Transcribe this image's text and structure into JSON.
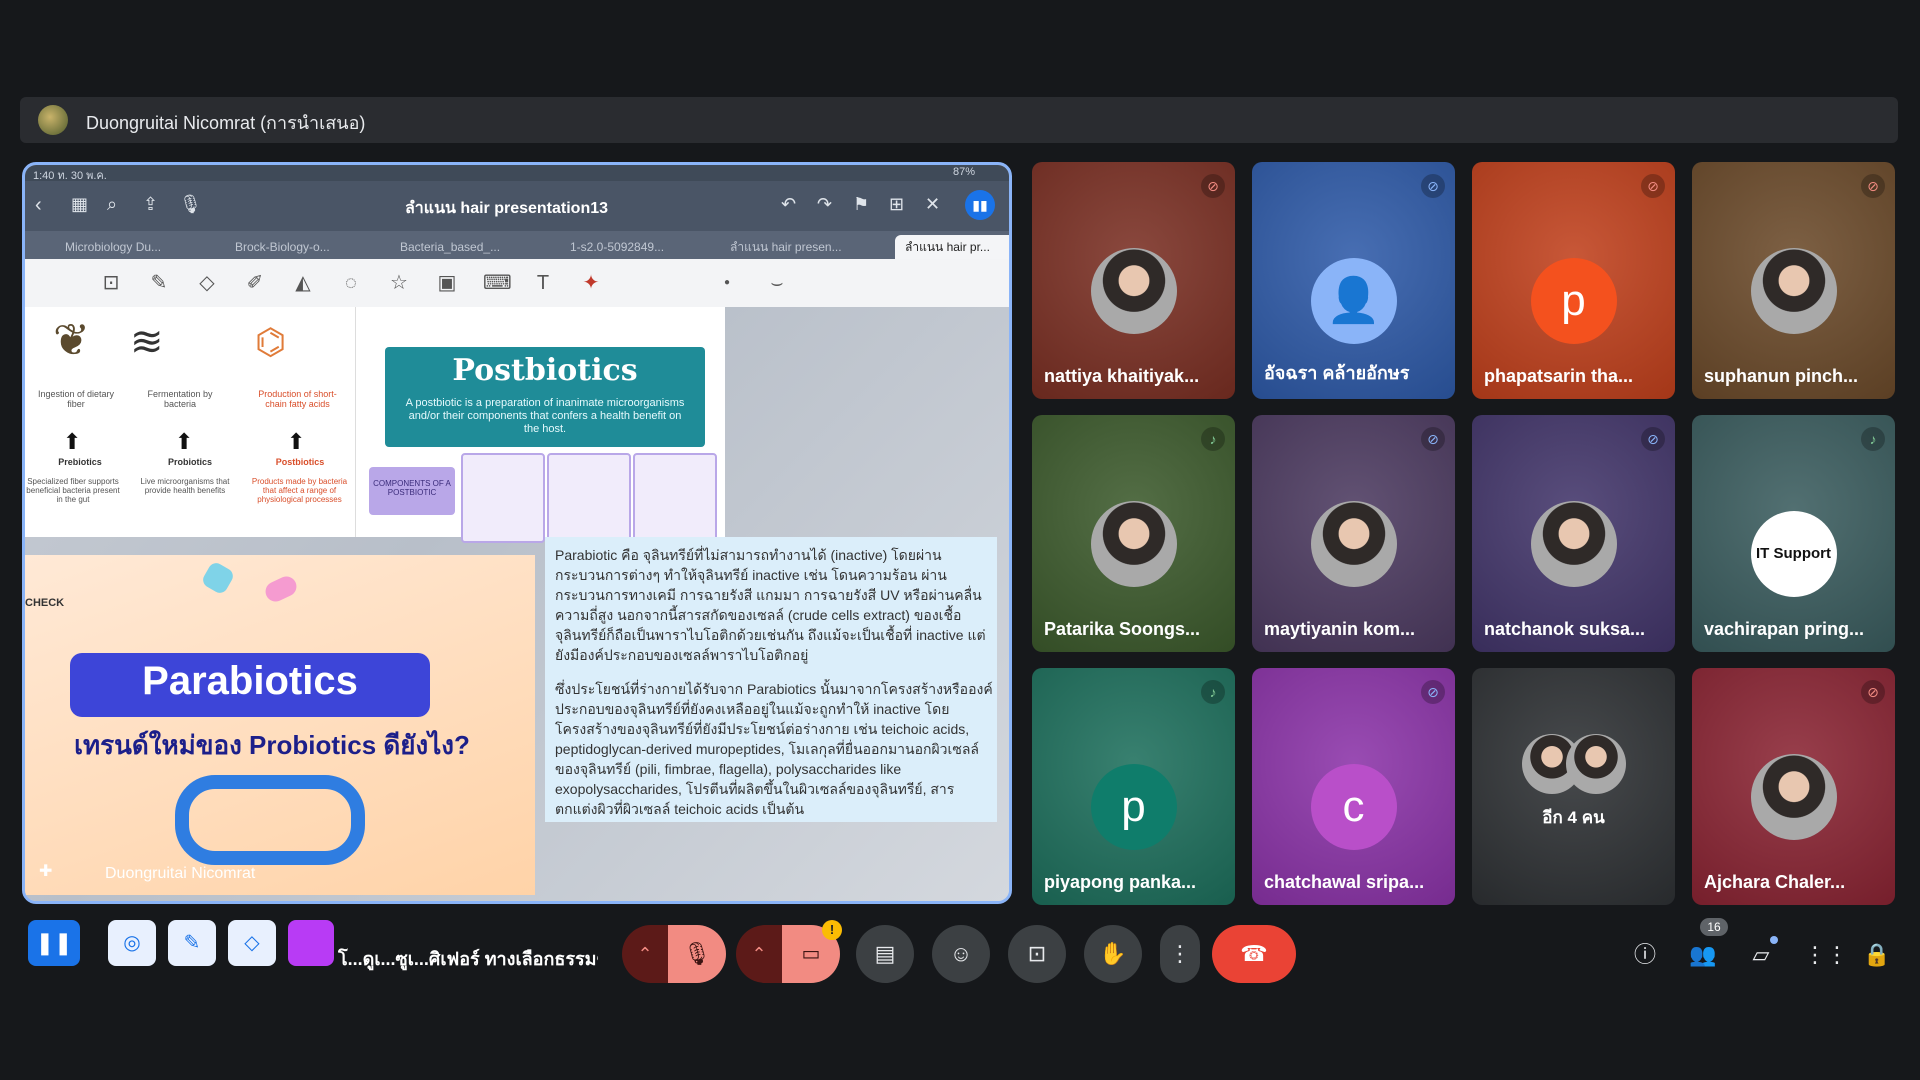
{
  "presenter": {
    "name": "Duongruitai Nicomrat (การนำเสนอ)"
  },
  "shared_screen": {
    "status_time": "1:40 ท. 30 พ.ค.",
    "battery": "87%",
    "doc_title": "ลำแนน hair presentation13",
    "tabs": [
      "Microbiology Du...",
      "Brock-Biology-o...",
      "Bacteria_based_...",
      "1-s2.0-5092849...",
      "ลำแนน hair presen...",
      "ลำแนน hair pr..."
    ],
    "slide1": {
      "steps": [
        "Ingestion of dietary fiber",
        "Fermentation by bacteria",
        "Production of short-chain fatty acids"
      ],
      "labels": [
        "Prebiotics",
        "Probiotics",
        "Postbiotics"
      ],
      "descs": [
        "Specialized fiber supports beneficial bacteria present in the gut",
        "Live microorganisms that provide health benefits",
        "Products made by bacteria that affect a range of physiological processes"
      ]
    },
    "postbiotics": {
      "title": "Postbiotics",
      "desc": "A postbiotic is a preparation of inanimate microorganisms and/or their components that confers a health benefit on the host.",
      "components_label": "COMPONENTS OF A POSTBIOTIC"
    },
    "parabiotics": {
      "check": "CHECK",
      "title": "Parabiotics",
      "subtitle": "เทรนด์ใหม่ของ Probiotics ดียังไง?"
    },
    "text_block": {
      "p1": "Parabiotic คือ จุลินทรีย์ที่ไม่สามารถทำงานได้ (inactive) โดยผ่านกระบวนการต่างๆ ทำให้จุลินทรีย์ inactive เช่น โดนความร้อน ผ่านกระบวนการทางเคมี การฉายรังสี แกมมา การฉายรังสี UV หรือผ่านคลื่นความถี่สูง นอกจากนี้สารสกัดของเซลล์ (crude cells extract) ของเชื้อจุลินทรีย์ก็ถือเป็นพาราไบโอติกด้วยเช่นกัน ถึงแม้จะเป็นเชื้อที่ inactive แต่ยังมีองค์ประกอบของเซลล์พาราไบโอติกอยู่",
      "p2": "ซึ่งประโยชน์ที่ร่างกายได้รับจาก Parabiotics นั้นมาจากโครงสร้างหรือองค์ประกอบของจุลินทรีย์ที่ยังคงเหลืออยู่ในแม้จะถูกทำให้ inactive โดยโครงสร้างของจุลินทรีย์ที่ยังมีประโยชน์ต่อร่างกาย เช่น teichoic acids, peptidoglycan-derived muropeptides, โมเลกุลที่ยื่นออกมานอกผิวเซลล์ของจุลินทรีย์ (pili, fimbrae, flagella), polysaccharides like exopolysaccharides, โปรตีนที่ผลิตขึ้นในผิวเซลล์ของจุลินทรีย์, สารตกแต่งผิวที่ผิวเซลล์ teichoic acids เป็นต้น"
    },
    "slide_presenter": "Duongruitai Nicomrat"
  },
  "participants": [
    {
      "name": "nattiya khaitiyak...",
      "type": "photo",
      "bg": "#7a2f23",
      "mic": "muted"
    },
    {
      "name": "อัจฉรา คล้ายอักษร",
      "type": "icon",
      "bg": "#2e5aa8",
      "mic": "muted-blue"
    },
    {
      "name": "phapatsarin tha...",
      "type": "letter",
      "letter": "p",
      "circle": "#f4511e",
      "bg": "#c0401c",
      "mic": "muted"
    },
    {
      "name": "suphanun pinch...",
      "type": "photo",
      "bg": "#6b4a2a",
      "mic": "muted"
    },
    {
      "name": "Patarika Soongs...",
      "type": "photo",
      "bg": "#3c5a2c",
      "mic": "active"
    },
    {
      "name": "maytiyanin kom...",
      "type": "photo",
      "bg": "#4c3a60",
      "mic": "muted-blue"
    },
    {
      "name": "natchanok suksa...",
      "type": "photo",
      "bg": "#42356a",
      "mic": "muted-blue"
    },
    {
      "name": "vachirapan pring...",
      "type": "itsupport",
      "bg": "#3a5c5e",
      "mic": "active",
      "logo_text": "IT Support"
    },
    {
      "name": "piyapong panka...",
      "type": "letter",
      "letter": "p",
      "circle": "#0f7d6b",
      "bg": "#1d6f5c",
      "mic": "active"
    },
    {
      "name": "chatchawal sripa...",
      "type": "letter",
      "letter": "c",
      "circle": "#b94fc9",
      "bg": "#8b33a8",
      "mic": "muted-blue"
    },
    {
      "name": "อีก 4 คน",
      "type": "more",
      "bg": "#2e3134",
      "mic": "none"
    },
    {
      "name": "Ajchara Chaler...",
      "type": "photo",
      "bg": "#8a2433",
      "mic": "muted"
    }
  ],
  "bottom": {
    "caption_text": "โ...ดูเ...ซูเ...ศิเฟอร์ ทางเลือกธรรมชาติที่ช่ว...",
    "participants_count": "16",
    "colors": {
      "end_call": "#ea4335",
      "mic_off": "#f28b82",
      "pause": "#1a73e8"
    }
  }
}
